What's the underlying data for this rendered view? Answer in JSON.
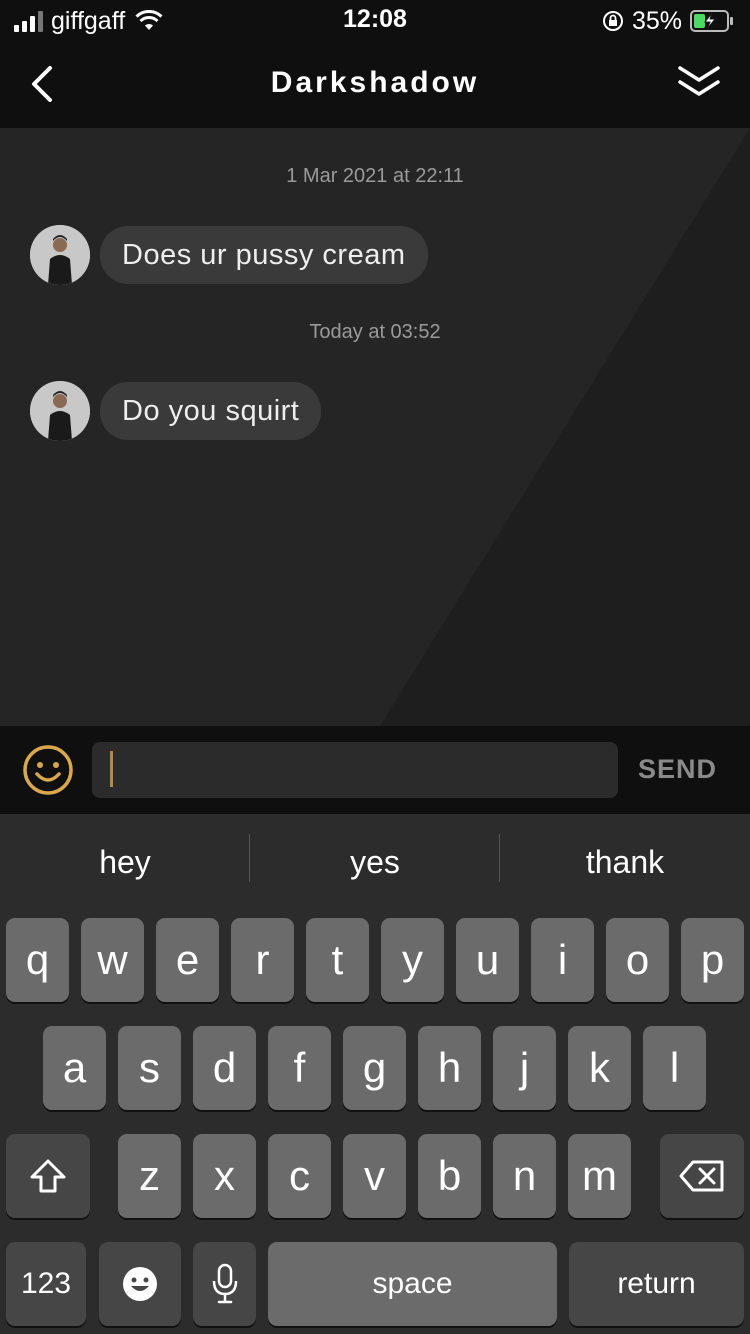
{
  "status_bar": {
    "carrier": "giffgaff",
    "time": "12:08",
    "battery_percent": "35%",
    "battery_level": 0.35,
    "battery_color": "#4cd964"
  },
  "header": {
    "title": "Darkshadow",
    "back_icon": "chevron-left-icon",
    "collapse_icon": "double-chevron-down-icon"
  },
  "chat": {
    "messages": [
      {
        "timestamp": "1 Mar 2021 at 22:11",
        "text": "Does ur pussy cream"
      },
      {
        "timestamp": "Today at 03:52",
        "text": "Do you squirt"
      }
    ]
  },
  "composer": {
    "emoji_icon": "smiley-face-icon",
    "input_value": "",
    "send_label": "SEND",
    "accent_color": "#d9a84e"
  },
  "keyboard": {
    "suggestions": [
      "hey",
      "yes",
      "thank"
    ],
    "row1": [
      "q",
      "w",
      "e",
      "r",
      "t",
      "y",
      "u",
      "i",
      "o",
      "p"
    ],
    "row2": [
      "a",
      "s",
      "d",
      "f",
      "g",
      "h",
      "j",
      "k",
      "l"
    ],
    "row3": [
      "z",
      "x",
      "c",
      "v",
      "b",
      "n",
      "m"
    ],
    "numbers_label": "123",
    "space_label": "space",
    "return_label": "return"
  }
}
